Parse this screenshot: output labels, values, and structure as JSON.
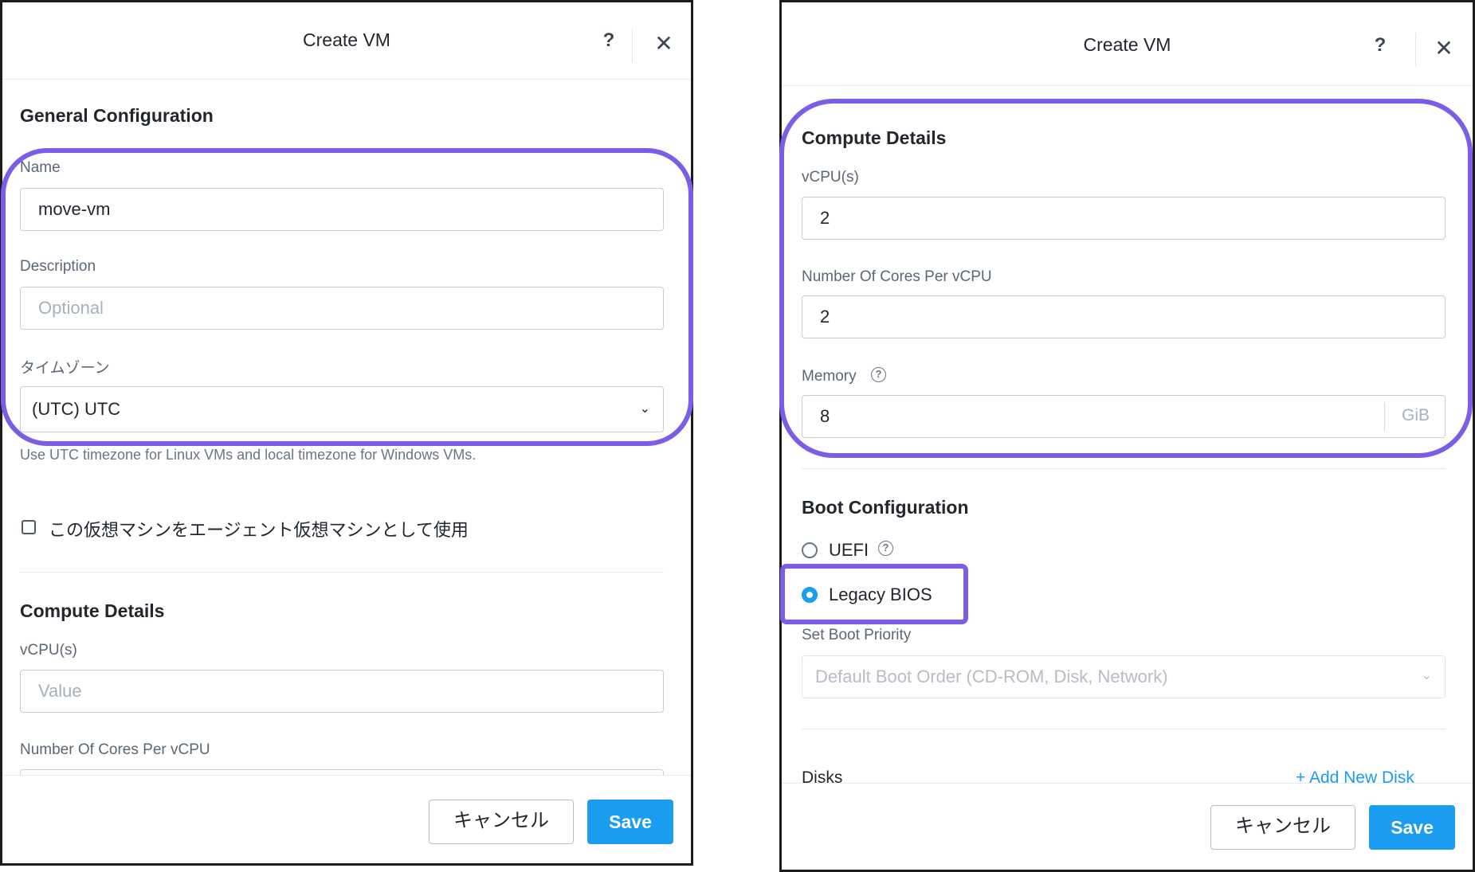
{
  "left": {
    "title": "Create VM",
    "help_label": "?",
    "close_label": "✕",
    "general_title": "General Configuration",
    "name_label": "Name",
    "name_value": "move-vm",
    "description_label": "Description",
    "description_placeholder": "Optional",
    "timezone_label": "タイムゾーン",
    "timezone_value": "(UTC) UTC",
    "timezone_helper": "Use UTC timezone for Linux VMs and local timezone for Windows VMs.",
    "agent_vm_label": "この仮想マシンをエージェント仮想マシンとして使用",
    "compute_title": "Compute Details",
    "vcpu_label": "vCPU(s)",
    "vcpu_placeholder": "Value",
    "cores_label": "Number Of Cores Per vCPU",
    "cancel_label": "キャンセル",
    "save_label": "Save"
  },
  "right": {
    "title": "Create VM",
    "help_label": "?",
    "close_label": "✕",
    "compute_title": "Compute Details",
    "vcpu_label": "vCPU(s)",
    "vcpu_value": "2",
    "cores_label": "Number Of Cores Per vCPU",
    "cores_value": "2",
    "memory_label": "Memory",
    "memory_value": "8",
    "memory_unit": "GiB",
    "boot_title": "Boot Configuration",
    "uefi_label": "UEFI",
    "legacy_label": "Legacy BIOS",
    "boot_priority_label": "Set Boot Priority",
    "boot_priority_value": "Default Boot Order (CD-ROM, Disk, Network)",
    "disks_title_partial": "Disks",
    "add_disk_partial": "+ Add New Disk",
    "cancel_label": "キャンセル",
    "save_label": "Save",
    "selected_boot": "Legacy BIOS"
  },
  "icons": {
    "help": "help-icon",
    "close": "close-icon",
    "chevron": "chevron-down-icon",
    "info": "info-circle-icon"
  },
  "colors": {
    "primary": "#1a9cf0",
    "highlight": "#7b5de8"
  }
}
